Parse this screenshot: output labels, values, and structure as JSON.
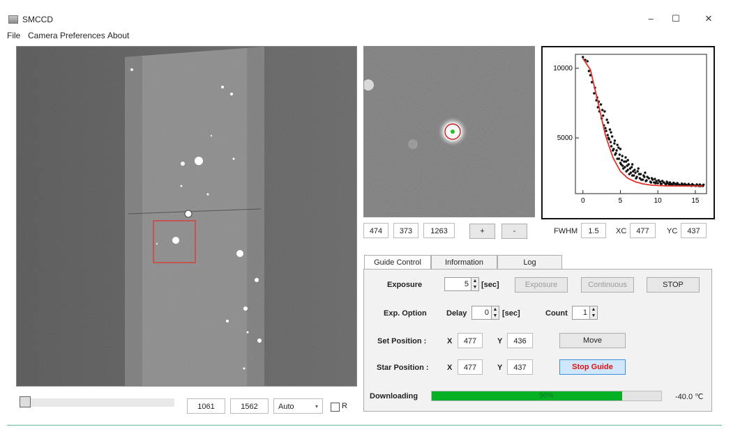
{
  "window": {
    "title": "SMCCD",
    "minimize": "–",
    "maximize": "☐",
    "close": "✕"
  },
  "menu": [
    "File",
    "Camera",
    "Preferences",
    "About"
  ],
  "image_controls": {
    "x_field": "474",
    "y_field": "373",
    "value_field": "1263",
    "plus": "+",
    "minus": "-"
  },
  "fit": {
    "fwhm_label": "FWHM",
    "fwhm": "1.5",
    "xc_label": "XC",
    "xc": "477",
    "yc_label": "YC",
    "yc": "437"
  },
  "tabs": [
    "Guide Control",
    "Information",
    "Log"
  ],
  "guide": {
    "exposure_label": "Exposure",
    "exposure_value": "5",
    "sec_unit": "[sec]",
    "exposure_btn": "Exposure",
    "continuous_btn": "Continuous",
    "stop_btn": "STOP",
    "exp_option_label": "Exp. Option",
    "delay_label": "Delay",
    "delay_value": "0",
    "delay_unit": "[sec]",
    "count_label": "Count",
    "count_value": "1",
    "set_position_label": "Set  Position :",
    "set_x_label": "X",
    "set_x": "477",
    "set_y_label": "Y",
    "set_y": "436",
    "move_btn": "Move",
    "star_position_label": "Star Position :",
    "star_x_label": "X",
    "star_x": "477",
    "star_y_label": "Y",
    "star_y": "437",
    "stop_guide_btn": "Stop Guide"
  },
  "status": {
    "downloading_label": "Downloading",
    "progress_text": "90%",
    "progress_fraction": 0.83,
    "temperature": "-40.0 ℃"
  },
  "bottom": {
    "width_field": "1061",
    "height_field": "1562",
    "scale_select": "Auto",
    "checkbox_label": "R",
    "slider_level": 0.03
  },
  "colors": {
    "accent_red": "#e0302a",
    "progress_green": "#06b025",
    "stop_guide_bg": "#cfe6fb",
    "stop_guide_text": "#e01010"
  },
  "chart_data": {
    "type": "scatter",
    "title": "",
    "xlabel": "",
    "ylabel": "",
    "xlim": [
      -1,
      16.5
    ],
    "ylim": [
      1000,
      11000
    ],
    "x_ticks": [
      "0",
      "5",
      "10",
      "15"
    ],
    "y_ticks": [
      "5000",
      "10000"
    ],
    "series": [
      {
        "values": [
          [
            0,
            10800
          ],
          [
            0.3,
            10600
          ],
          [
            0.6,
            10500
          ],
          [
            0.8,
            9800
          ],
          [
            1.0,
            9500
          ],
          [
            1.2,
            9000
          ],
          [
            1.5,
            8200
          ],
          [
            1.8,
            7700
          ],
          [
            2.0,
            7200
          ],
          [
            2.2,
            6900
          ],
          [
            2.5,
            6400
          ],
          [
            2.8,
            5900
          ],
          [
            3.0,
            5700
          ],
          [
            3.3,
            5200
          ],
          [
            3.5,
            4900
          ],
          [
            3.8,
            4400
          ],
          [
            4.0,
            4100
          ],
          [
            4.3,
            3800
          ],
          [
            4.6,
            3500
          ],
          [
            5.0,
            3200
          ],
          [
            5.3,
            3000
          ],
          [
            5.6,
            2900
          ],
          [
            6.0,
            2700
          ],
          [
            6.4,
            2500
          ],
          [
            6.8,
            2300
          ],
          [
            7.2,
            2200
          ],
          [
            7.6,
            2100
          ],
          [
            8.0,
            2000
          ],
          [
            8.5,
            1950
          ],
          [
            9.0,
            1850
          ],
          [
            9.5,
            1800
          ],
          [
            10.0,
            1750
          ],
          [
            10.5,
            1700
          ],
          [
            11.0,
            1700
          ],
          [
            11.5,
            1650
          ],
          [
            12.0,
            1650
          ],
          [
            12.5,
            1600
          ],
          [
            13.0,
            1600
          ],
          [
            13.5,
            1600
          ],
          [
            14.0,
            1580
          ],
          [
            14.5,
            1560
          ],
          [
            15.0,
            1560
          ],
          [
            15.5,
            1550
          ],
          [
            16.0,
            1550
          ],
          [
            2.4,
            7400
          ],
          [
            2.9,
            6900
          ],
          [
            3.2,
            6300
          ],
          [
            3.6,
            5600
          ],
          [
            3.9,
            5100
          ],
          [
            4.2,
            4600
          ],
          [
            4.5,
            4100
          ],
          [
            4.9,
            3800
          ],
          [
            5.2,
            3400
          ],
          [
            5.5,
            3300
          ],
          [
            5.9,
            3000
          ],
          [
            6.3,
            2800
          ],
          [
            6.7,
            2600
          ],
          [
            7.0,
            2500
          ],
          [
            7.5,
            2400
          ],
          [
            8.2,
            2200
          ],
          [
            8.8,
            2100
          ],
          [
            9.3,
            2000
          ],
          [
            9.8,
            1900
          ],
          [
            10.3,
            1850
          ],
          [
            10.8,
            1800
          ],
          [
            11.3,
            1750
          ],
          [
            11.8,
            1700
          ],
          [
            12.3,
            1700
          ],
          [
            12.8,
            1650
          ],
          [
            13.3,
            1650
          ],
          [
            13.8,
            1620
          ],
          [
            14.3,
            1600
          ],
          [
            14.8,
            1600
          ],
          [
            15.3,
            1580
          ],
          [
            15.8,
            1570
          ],
          [
            3.1,
            5500
          ],
          [
            3.4,
            5000
          ],
          [
            3.7,
            4700
          ],
          [
            4.1,
            4200
          ],
          [
            4.4,
            3900
          ],
          [
            4.8,
            3500
          ],
          [
            5.1,
            3100
          ],
          [
            5.4,
            2800
          ],
          [
            5.8,
            2600
          ],
          [
            6.2,
            2400
          ],
          [
            6.6,
            2300
          ],
          [
            7.1,
            2100
          ],
          [
            7.8,
            2000
          ],
          [
            8.4,
            1900
          ],
          [
            9.1,
            1800
          ],
          [
            9.7,
            1750
          ],
          [
            10.4,
            1700
          ],
          [
            11.1,
            1680
          ],
          [
            11.7,
            1650
          ],
          [
            12.4,
            1620
          ],
          [
            13.1,
            1600
          ],
          [
            13.7,
            1590
          ],
          [
            14.4,
            1580
          ],
          [
            15.1,
            1560
          ],
          [
            15.7,
            1550
          ],
          [
            1.6,
            8600
          ],
          [
            1.9,
            7900
          ],
          [
            2.1,
            7600
          ],
          [
            2.6,
            7000
          ],
          [
            2.7,
            6600
          ],
          [
            3.35,
            6100
          ],
          [
            3.75,
            5400
          ],
          [
            4.25,
            4800
          ],
          [
            4.75,
            4300
          ],
          [
            5.25,
            3700
          ],
          [
            5.75,
            3300
          ],
          [
            6.1,
            3100
          ],
          [
            6.5,
            2900
          ],
          [
            6.9,
            2700
          ],
          [
            7.3,
            2600
          ],
          [
            7.7,
            2400
          ],
          [
            8.1,
            2300
          ],
          [
            8.6,
            2200
          ],
          [
            9.2,
            2100
          ],
          [
            9.6,
            2050
          ],
          [
            10.1,
            1950
          ],
          [
            10.6,
            1900
          ],
          [
            11.2,
            1850
          ],
          [
            11.6,
            1800
          ],
          [
            12.1,
            1780
          ],
          [
            12.6,
            1750
          ],
          [
            13.2,
            1720
          ],
          [
            13.6,
            1700
          ],
          [
            14.1,
            1690
          ],
          [
            14.6,
            1680
          ],
          [
            15.2,
            1660
          ],
          [
            15.6,
            1650
          ],
          [
            16.1,
            1640
          ],
          [
            4.6,
            4500
          ],
          [
            5.0,
            4200
          ],
          [
            5.7,
            3600
          ],
          [
            6.0,
            3400
          ],
          [
            6.6,
            3100
          ],
          [
            7.4,
            2800
          ],
          [
            8.3,
            2500
          ]
        ]
      },
      {
        "fit": true,
        "values": [
          [
            0,
            10700
          ],
          [
            1,
            9900
          ],
          [
            2,
            7600
          ],
          [
            3,
            5200
          ],
          [
            4,
            3600
          ],
          [
            5,
            2600
          ],
          [
            6,
            2100
          ],
          [
            7,
            1850
          ],
          [
            8,
            1700
          ],
          [
            9,
            1620
          ],
          [
            10,
            1580
          ],
          [
            11,
            1560
          ],
          [
            12,
            1550
          ],
          [
            13,
            1550
          ],
          [
            14,
            1550
          ],
          [
            15,
            1550
          ],
          [
            16,
            1550
          ]
        ]
      }
    ]
  }
}
